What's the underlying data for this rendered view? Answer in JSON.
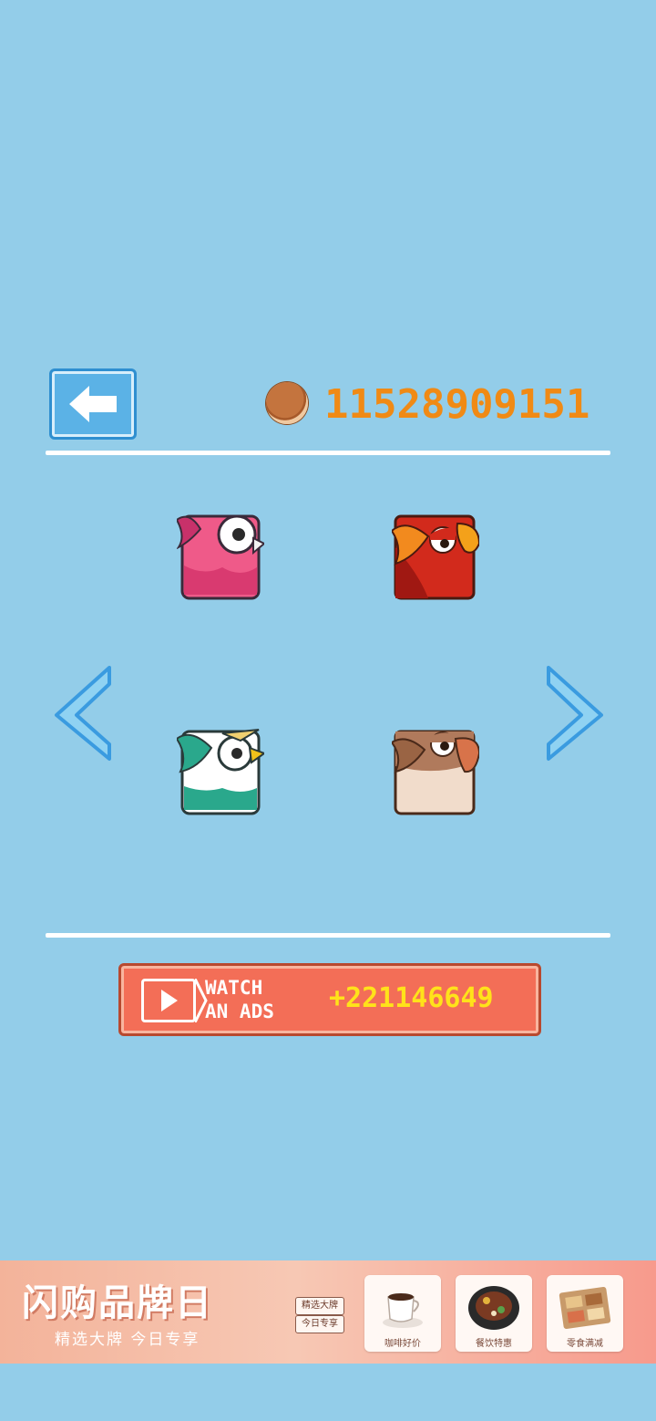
{
  "header": {
    "back_icon": "left-arrow-icon",
    "coin_icon": "coin-icon",
    "coin_count": "11528909151"
  },
  "carousel": {
    "prev_icon": "chevron-left-icon",
    "next_icon": "chevron-right-icon",
    "birds": [
      {
        "name": "pink-bird",
        "colors": [
          "#e9457a",
          "#f27aa2"
        ]
      },
      {
        "name": "red-bird",
        "colors": [
          "#d22a1c",
          "#f18a1e"
        ]
      },
      {
        "name": "green-bird",
        "colors": [
          "#2aa88c",
          "#ffffff"
        ]
      },
      {
        "name": "brown-bird",
        "colors": [
          "#b07a5c",
          "#f1dccb"
        ]
      }
    ]
  },
  "watch_ad": {
    "play_icon": "play-icon",
    "line1": "WATCH",
    "line2": "AN ADS",
    "reward": "+221146649"
  },
  "ad_banner": {
    "title": "闪购品牌日",
    "subtitle": "精选大牌 今日专享",
    "tag1": "精选大牌",
    "tag2": "今日专享",
    "cards": [
      {
        "label": "咖啡好价",
        "icon": "coffee-cup-icon"
      },
      {
        "label": "餐饮特惠",
        "icon": "steak-plate-icon"
      },
      {
        "label": "零食满减",
        "icon": "snack-box-icon"
      }
    ]
  },
  "colors": {
    "background": "#93cde9",
    "coin_text": "#f08a15",
    "reward_text": "#ffe21a",
    "ad_button": "#f36e57"
  }
}
